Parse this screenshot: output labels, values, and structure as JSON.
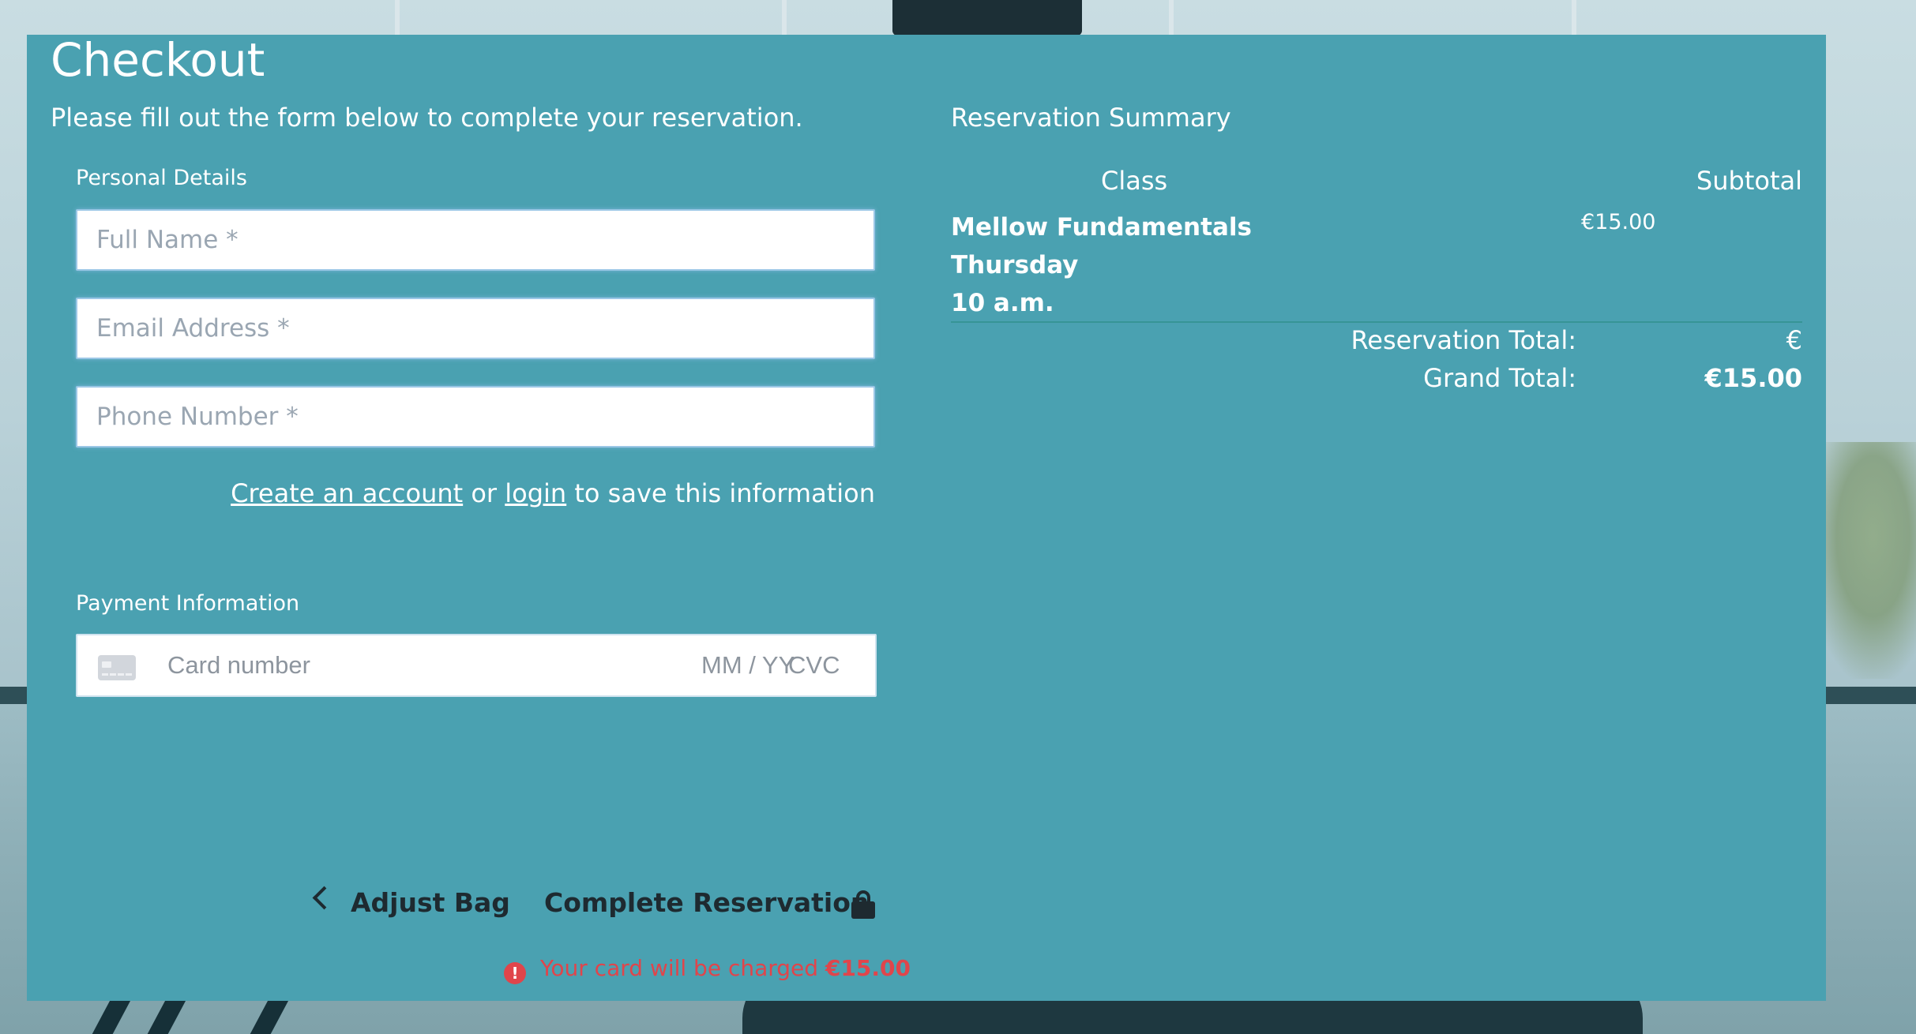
{
  "page": {
    "title": "Checkout",
    "intro": "Please fill out the form below to complete your reservation."
  },
  "personal": {
    "label": "Personal Details",
    "full_name": {
      "value": "",
      "placeholder": "Full Name *"
    },
    "email": {
      "value": "",
      "placeholder": "Email Address *"
    },
    "phone": {
      "value": "",
      "placeholder": "Phone Number *"
    },
    "create_account_link": "Create an account",
    "or_text": "or",
    "login_link": "login",
    "save_text": "to save this information"
  },
  "payment": {
    "label": "Payment Information",
    "card_icon": "credit-card-icon",
    "card_placeholder": "Card number",
    "expiry_placeholder": "MM / YY",
    "cvc_placeholder": "CVC"
  },
  "actions": {
    "adjust_bag": "Adjust Bag",
    "complete": "Complete Reservation",
    "lock_icon": "lock-icon"
  },
  "notice": {
    "icon": "alert-icon",
    "text": "Your card will be charged",
    "amount": "€15.00",
    "color": "#e0454b"
  },
  "summary": {
    "title": "Reservation Summary",
    "col_class": "Class",
    "col_subtotal": "Subtotal",
    "item": {
      "name": "Mellow Fundamentals",
      "day": "Thursday",
      "time": "10 a.m.",
      "price": "€15.00"
    },
    "reservation_total_label": "Reservation Total:",
    "reservation_total_value": "€",
    "grand_total_label": "Grand Total:",
    "grand_total_value": "€15.00"
  },
  "colors": {
    "panel": "#4aa1b1",
    "action_text": "#1e2a30"
  }
}
